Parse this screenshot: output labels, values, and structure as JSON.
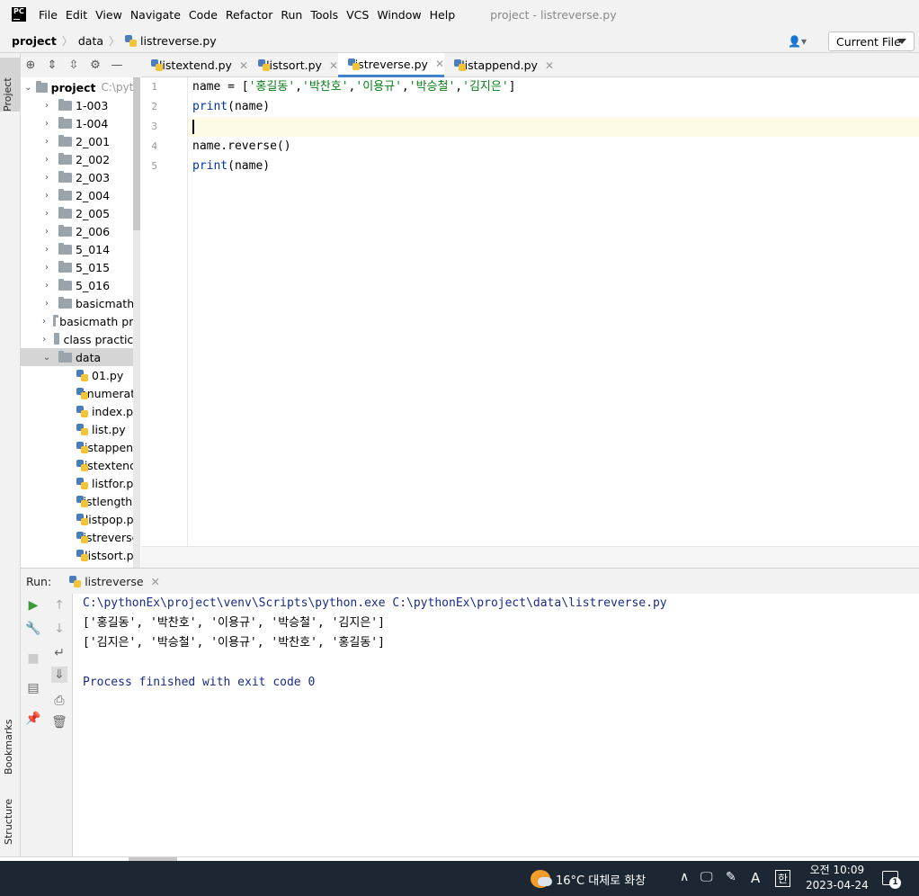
{
  "menubar": {
    "logo": "PC",
    "items": [
      "File",
      "Edit",
      "View",
      "Navigate",
      "Code",
      "Refactor",
      "Run",
      "Tools",
      "VCS",
      "Window",
      "Help"
    ],
    "window_title": "project - listreverse.py"
  },
  "navbar": {
    "breadcrumbs": [
      "project",
      "data",
      "listreverse.py"
    ],
    "run_config": "Current File"
  },
  "side_tabs": {
    "project": "Project",
    "bookmarks": "Bookmarks",
    "structure": "Structure"
  },
  "project_tree": {
    "root": {
      "label": "project",
      "path": "C:\\pyth"
    },
    "folders": [
      "1-003",
      "1-004",
      "2_001",
      "2_002",
      "2_003",
      "2_004",
      "2_005",
      "2_006",
      "5_014",
      "5_015",
      "5_016",
      "basicmath",
      "basicmath pra",
      "class practice",
      "data"
    ],
    "files": [
      "01.py",
      "enumerate",
      "index.py",
      "list.py",
      "listappend",
      "listextend.",
      "listfor.py",
      "listlength.p",
      "listpop.py",
      "listreverse.",
      "listsort.py"
    ]
  },
  "editor_tabs": [
    {
      "label": "listextend.py",
      "active": false
    },
    {
      "label": "listsort.py",
      "active": false
    },
    {
      "label": "listreverse.py",
      "active": true
    },
    {
      "label": "listappend.py",
      "active": false
    }
  ],
  "code": {
    "line_numbers": [
      "1",
      "2",
      "3",
      "4",
      "5"
    ],
    "l1_name": "name = [",
    "l1_s1": "'홍길동'",
    "l1_s2": "'박찬호'",
    "l1_s3": "'이용규'",
    "l1_s4": "'박승철'",
    "l1_s5": "'김지은'",
    "l1_comma": ",",
    "l1_end": "]",
    "print_kw": "print",
    "print_arg": "(name)",
    "l4": "name.reverse()"
  },
  "run_panel": {
    "label": "Run:",
    "tab": "listreverse",
    "output": [
      "C:\\pythonEx\\project\\venv\\Scripts\\python.exe C:\\pythonEx\\project\\data\\listreverse.py",
      "['홍길동', '박찬호', '이용규', '박승철', '김지은']",
      "['김지은', '박승철', '이용규', '박찬호', '홍길동']",
      "",
      "Process finished with exit code 0"
    ]
  },
  "taskbar": {
    "weather": "16°C 대체로 화창",
    "ime_a": "A",
    "ime_han": "한",
    "time": "오전 10:09",
    "date": "2023-04-24",
    "notifications": "1"
  }
}
